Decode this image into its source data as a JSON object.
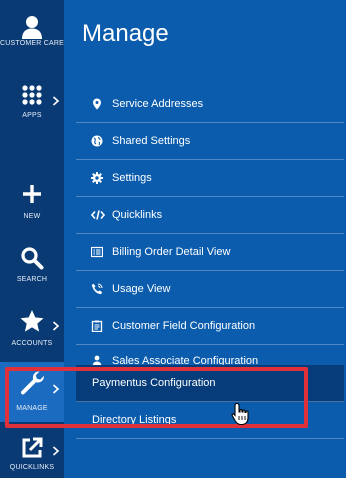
{
  "sidebar": {
    "items": [
      {
        "label": "CUSTOMER CARE",
        "icon": "person-icon",
        "has_chevron": false
      },
      {
        "label": "APPS",
        "icon": "grid-icon",
        "has_chevron": true
      },
      {
        "label": "NEW",
        "icon": "plus-icon",
        "has_chevron": false
      },
      {
        "label": "SEARCH",
        "icon": "search-icon",
        "has_chevron": false
      },
      {
        "label": "ACCOUNTS",
        "icon": "star-icon",
        "has_chevron": true
      },
      {
        "label": "MANAGE",
        "icon": "wrench-icon",
        "has_chevron": true,
        "active": true
      },
      {
        "label": "QUICKLINKS",
        "icon": "external-link-icon",
        "has_chevron": true
      }
    ]
  },
  "panel": {
    "title": "Manage",
    "items": [
      {
        "label": "Service Addresses",
        "icon": "map-pin-icon"
      },
      {
        "label": "Shared Settings",
        "icon": "globe-icon"
      },
      {
        "label": "Settings",
        "icon": "gear-icon"
      },
      {
        "label": "Quicklinks",
        "icon": "code-icon"
      },
      {
        "label": "Billing Order Detail View",
        "icon": "list-card-icon"
      },
      {
        "label": "Usage View",
        "icon": "phone-icon"
      },
      {
        "label": "Customer Field Configuration",
        "icon": "clipboard-icon"
      },
      {
        "label": "Sales Associate Configuration",
        "icon": "person-tie-icon"
      },
      {
        "label": "Paymentus Configuration",
        "icon": "",
        "highlighted": true
      },
      {
        "label": "Directory Listings",
        "icon": ""
      }
    ]
  },
  "colors": {
    "rail_bg": "#0a3a73",
    "panel_bg": "#0b5cad",
    "active_rail_bg": "#1b6cc0",
    "highlight_bg": "#063c7a",
    "annotation_red": "#e0303a"
  }
}
